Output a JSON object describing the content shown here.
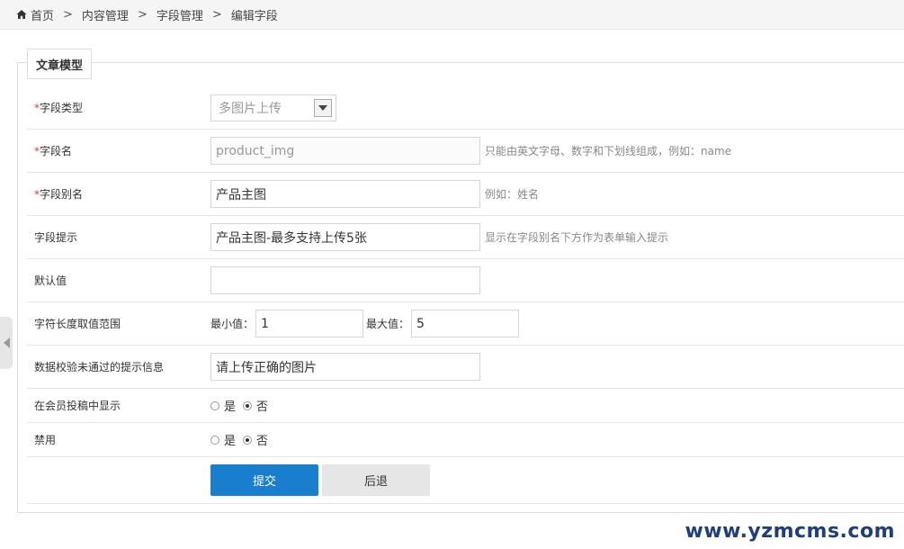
{
  "breadcrumb": {
    "home": "首页",
    "items": [
      "内容管理",
      "字段管理",
      "编辑字段"
    ],
    "separator": ">"
  },
  "panel": {
    "legend": "文章模型"
  },
  "form": {
    "field_type": {
      "required_mark": "*",
      "label": "字段类型",
      "value": "多图片上传"
    },
    "field_name": {
      "required_mark": "*",
      "label": "字段名",
      "value": "product_img",
      "hint": "只能由英文字母、数字和下划线组成，例如：name"
    },
    "field_alias": {
      "required_mark": "*",
      "label": "字段别名",
      "value": "产品主图",
      "hint": "例如：姓名"
    },
    "field_tip": {
      "label": "字段提示",
      "value": "产品主图-最多支持上传5张",
      "hint": "显示在字段别名下方作为表单输入提示"
    },
    "default_value": {
      "label": "默认值",
      "value": ""
    },
    "length_range": {
      "label": "字符长度取值范围",
      "min_label": "最小值：",
      "min_value": "1",
      "max_label": "最大值：",
      "max_value": "5"
    },
    "error_msg": {
      "label": "数据校验未通过的提示信息",
      "value": "请上传正确的图片"
    },
    "show_in_member": {
      "label": "在会员投稿中显示",
      "yes": "是",
      "no": "否",
      "selected": "否"
    },
    "disabled": {
      "label": "禁用",
      "yes": "是",
      "no": "否",
      "selected": "否"
    },
    "submit_label": "提交",
    "back_label": "后退"
  },
  "watermark": "www.yzmcms.com",
  "colors": {
    "primary": "#1a7ecf",
    "required": "#e4393c"
  }
}
